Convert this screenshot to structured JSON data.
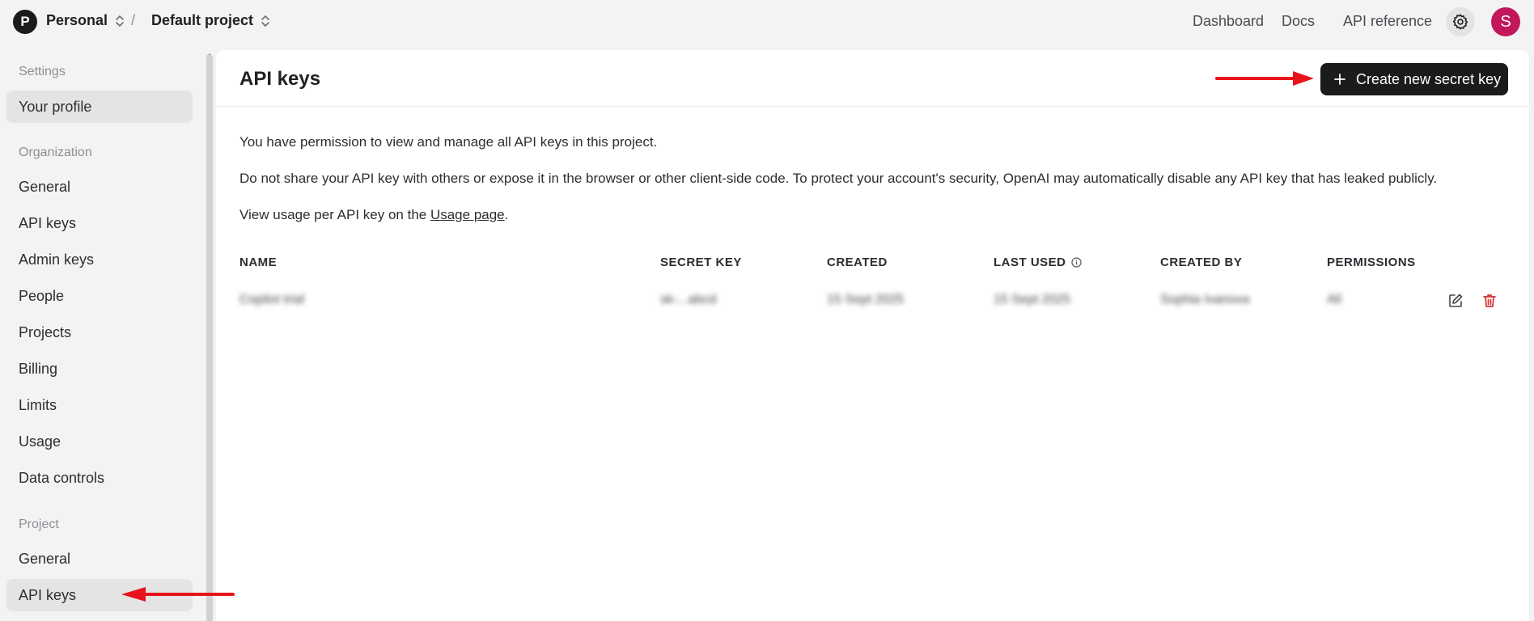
{
  "topbar": {
    "org_initial": "P",
    "org_name": "Personal",
    "separator": "/",
    "project_name": "Default project",
    "nav": [
      "Dashboard",
      "Docs",
      "API reference"
    ],
    "user_initial": "S",
    "gear_icon": "gear-icon"
  },
  "sidebar": {
    "settings_heading": "Settings",
    "your_profile": "Your profile",
    "organization_heading": "Organization",
    "org_items": [
      "General",
      "API keys",
      "Admin keys",
      "People",
      "Projects",
      "Billing",
      "Limits",
      "Usage",
      "Data controls"
    ],
    "project_heading": "Project",
    "project_items": [
      "General",
      "API keys"
    ]
  },
  "main": {
    "title": "API keys",
    "create_button": "Create new secret key",
    "p1": "You have permission to view and manage all API keys in this project.",
    "p2": "Do not share your API key with others or expose it in the browser or other client-side code. To protect your account's security, OpenAI may automatically disable any API key that has leaked publicly.",
    "p3_prefix": "View usage per API key on the ",
    "p3_link": "Usage page",
    "p3_suffix": ".",
    "columns": [
      "NAME",
      "SECRET KEY",
      "CREATED",
      "LAST USED",
      "CREATED BY",
      "PERMISSIONS"
    ],
    "row": [
      "Copilot trial",
      "sk-...abcd",
      "15 Sept 2025",
      "15 Sept 2025",
      "Sophia Ivanova",
      "All"
    ]
  },
  "colors": {
    "accent_dark": "#1b1b1b",
    "user_avatar": "#c2185b",
    "delete_red": "#d32f2f",
    "annotation_red": "#e8131b"
  }
}
